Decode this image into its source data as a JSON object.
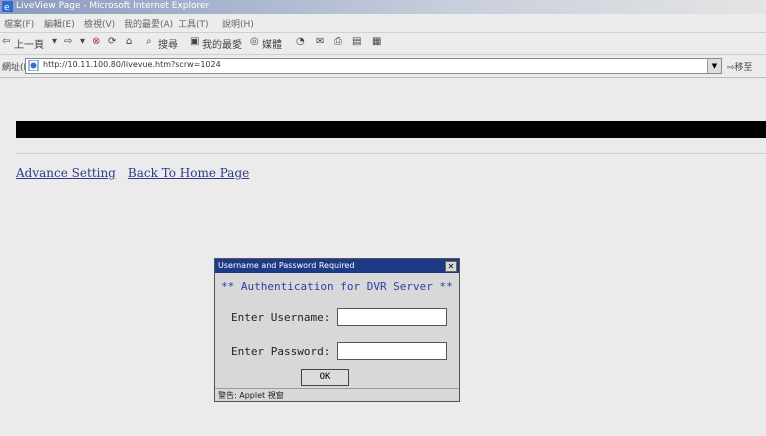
{
  "window": {
    "title": "LiveView Page - Microsoft Internet Explorer"
  },
  "menu": [
    "檔案(F)",
    "編輯(E)",
    "檢視(V)",
    "我的最愛(A)",
    "工具(T)",
    "說明(H)"
  ],
  "toolbar": {
    "back_label": "上一頁",
    "search_label": "搜尋",
    "favorites_label": "我的最愛",
    "media_label": "媒體"
  },
  "address": {
    "label": "網址(D)",
    "url": "http://10.11.100.80/livevue.htm?scrw=1024",
    "go_label": "移至"
  },
  "page": {
    "links": [
      "Advance Setting",
      "Back To Home Page"
    ]
  },
  "dialog": {
    "title": "Username and Password Required",
    "heading": "** Authentication for DVR Server **",
    "username_label": "Enter Username:",
    "password_label": "Enter Password:",
    "username_value": "",
    "password_value": "",
    "ok_label": "OK",
    "status": "警告: Applet 視窗"
  },
  "colors": {
    "link": "#2f3a8a",
    "dialog_title_bg": "#1e3a86",
    "dialog_heading": "#2a3fa6"
  }
}
